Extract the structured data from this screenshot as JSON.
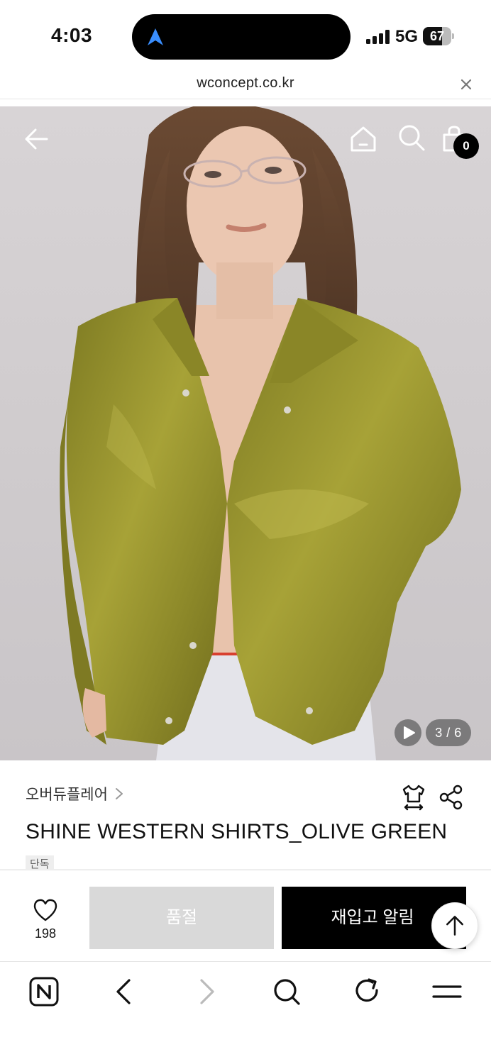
{
  "status": {
    "time": "4:03",
    "network": "5G",
    "battery": "67",
    "battery_level": 0.67
  },
  "browser": {
    "url": "wconcept.co.kr"
  },
  "header": {
    "cart_count": "0"
  },
  "gallery": {
    "counter": "3 / 6"
  },
  "product": {
    "brand": "오버듀플레어",
    "title": "SHINE WESTERN SHIRTS_OLIVE GREEN",
    "tag": "단독"
  },
  "actions": {
    "like_count": "198",
    "soldout_label": "품절",
    "restock_label": "재입고 알림"
  },
  "icons": {
    "back": "back-arrow-icon",
    "home": "home-icon",
    "search": "search-icon",
    "bag": "shopping-bag-icon",
    "play": "play-icon",
    "size": "size-guide-icon",
    "share": "share-icon",
    "like": "heart-icon",
    "top": "arrow-up-icon"
  },
  "colors": {
    "accent": "#000000",
    "soldout_bg": "#d9d9d9",
    "island_nav": "#3a8dfc"
  }
}
